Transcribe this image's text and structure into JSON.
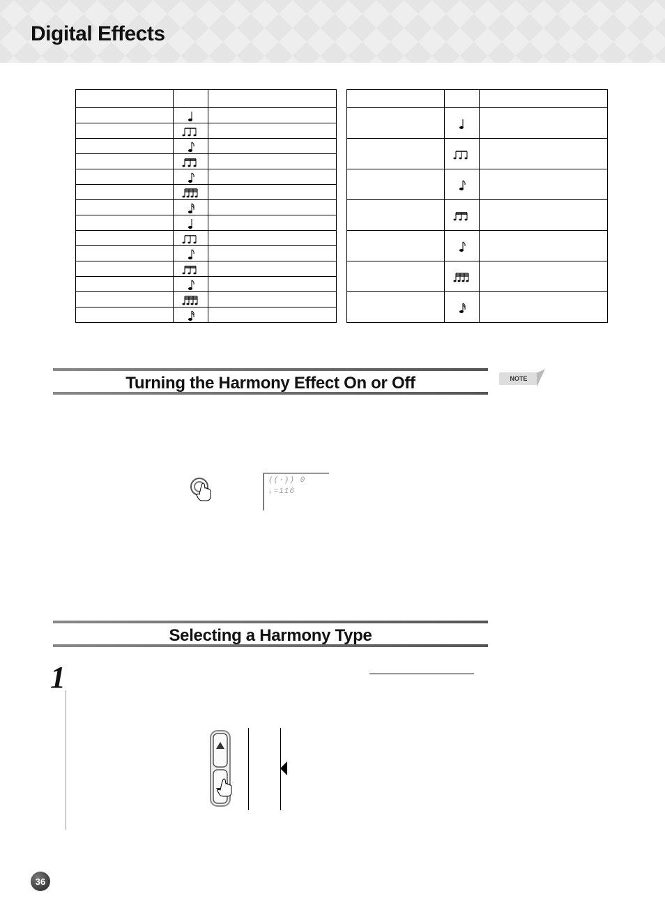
{
  "page_title": "Digital Effects",
  "page_number": "36",
  "note_label": "NOTE",
  "sections": {
    "harmony_on_off": {
      "title": "Turning the Harmony Effect On or Off"
    },
    "select_harmony": {
      "title": "Selecting a Harmony Type"
    }
  },
  "lcd": {
    "line1": "((·)) 0",
    "line2": "♩=116"
  },
  "icons": {
    "quarter": "quarter",
    "triplet_quarter": "triplet-quarter",
    "eighth": "eighth",
    "beam16": "beam-sixteenth",
    "eighth_flag": "eighth-flag",
    "beam32": "beam-thirtysecond",
    "sixteenth_flag": "sixteenth-flag"
  },
  "left_table_rows": [
    {
      "icon": "quarter"
    },
    {
      "icon": "triplet-quarter"
    },
    {
      "icon": "eighth"
    },
    {
      "icon": "beam-sixteenth"
    },
    {
      "icon": "eighth-flag"
    },
    {
      "icon": "beam-thirtysecond"
    },
    {
      "icon": "sixteenth-flag"
    },
    {
      "icon": "quarter"
    },
    {
      "icon": "triplet-quarter"
    },
    {
      "icon": "eighth"
    },
    {
      "icon": "beam-sixteenth"
    },
    {
      "icon": "eighth-flag"
    },
    {
      "icon": "beam-thirtysecond"
    },
    {
      "icon": "sixteenth-flag"
    }
  ],
  "right_table_rows": [
    {
      "icon": "quarter"
    },
    {
      "icon": "triplet-quarter"
    },
    {
      "icon": "eighth"
    },
    {
      "icon": "beam-sixteenth"
    },
    {
      "icon": "eighth-flag"
    },
    {
      "icon": "beam-thirtysecond"
    },
    {
      "icon": "sixteenth-flag"
    }
  ],
  "step1": {
    "number": "1"
  }
}
